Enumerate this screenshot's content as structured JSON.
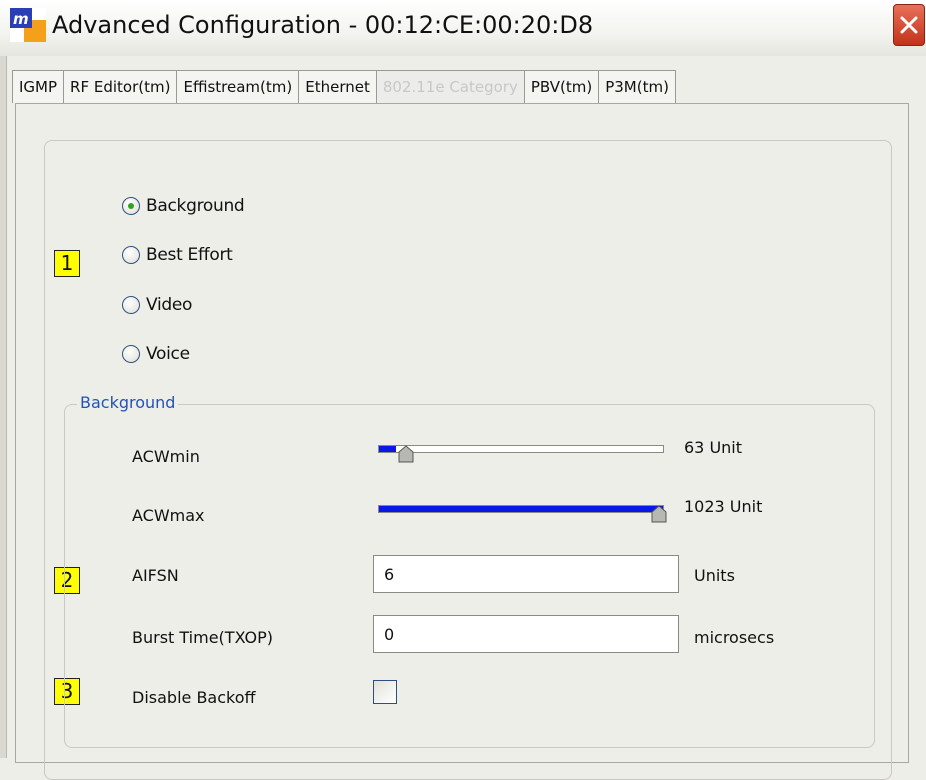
{
  "window": {
    "title": "Advanced Configuration - 00:12:CE:00:20:D8",
    "logo_icon": "app-m-logo-icon",
    "close_icon": "close-x-icon"
  },
  "tabs": [
    {
      "label": "IGMP",
      "active": false
    },
    {
      "label": "RF Editor(tm)",
      "active": false
    },
    {
      "label": "Effistream(tm)",
      "active": false
    },
    {
      "label": "Ethernet",
      "active": false
    },
    {
      "label": "802.11e Category",
      "active": true
    },
    {
      "label": "PBV(tm)",
      "active": false
    },
    {
      "label": "P3M(tm)",
      "active": false
    }
  ],
  "categories": {
    "options": [
      {
        "label": "Background",
        "checked": true
      },
      {
        "label": "Best Effort",
        "checked": false
      },
      {
        "label": "Video",
        "checked": false
      },
      {
        "label": "Voice",
        "checked": false
      }
    ]
  },
  "group": {
    "title": "Background",
    "acwmin": {
      "label": "ACWmin",
      "value_text": "63 Unit",
      "fraction": 0.06
    },
    "acwmax": {
      "label": "ACWmax",
      "value_text": "1023 Unit",
      "fraction": 1.0
    },
    "aifsn": {
      "label": "AIFSN",
      "value": "6",
      "unit": "Units"
    },
    "burst": {
      "label": "Burst Time(TXOP)",
      "value": "0",
      "unit": "microsecs"
    },
    "backoff": {
      "label": "Disable Backoff",
      "checked": false
    }
  },
  "callouts": [
    "1",
    "2",
    "3"
  ],
  "colors": {
    "slider_fill": "#0a18e6",
    "legend_text": "#2253b8",
    "callout_bg": "#ffff00",
    "close_button": "#c3321b"
  }
}
